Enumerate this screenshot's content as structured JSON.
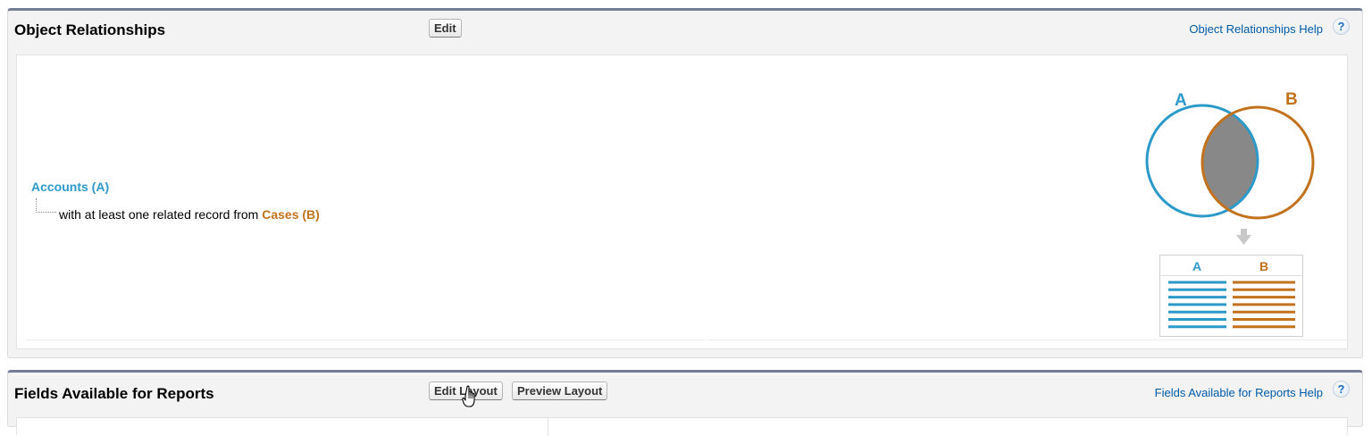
{
  "object_relationships": {
    "title": "Object Relationships",
    "edit_label": "Edit",
    "help_label": "Object Relationships Help",
    "help_icon": "?",
    "primary_object": "Accounts (A)",
    "relationship_text": "with at least one related record from",
    "secondary_object": "Cases (B)",
    "venn": {
      "label_a": "A",
      "label_b": "B",
      "color_a": "#2c9ac9",
      "color_b": "#c2721c",
      "overlap_color": "#888888"
    },
    "result_table": {
      "header_a": "A",
      "header_b": "B"
    }
  },
  "fields_available": {
    "title": "Fields Available for Reports",
    "edit_layout_label": "Edit Layout",
    "preview_layout_label": "Preview Layout",
    "help_label": "Fields Available for Reports Help",
    "help_icon": "?"
  }
}
